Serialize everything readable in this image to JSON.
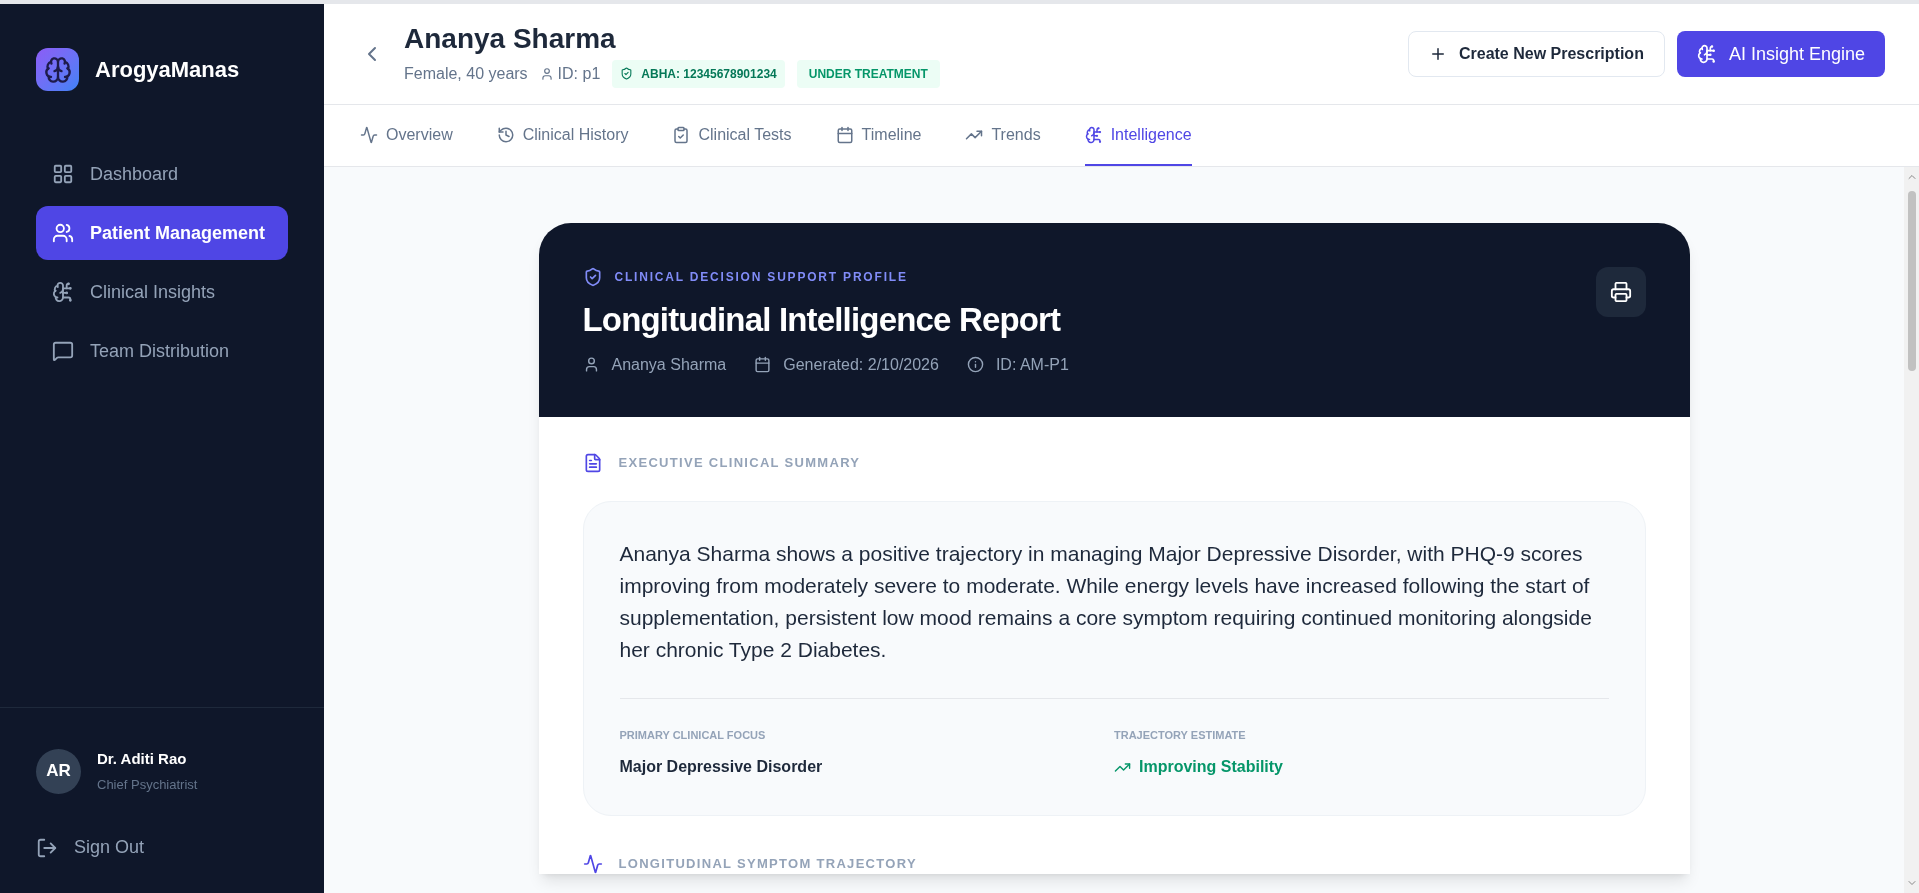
{
  "app": {
    "name": "ArogyaManas"
  },
  "sidebar": {
    "nav": [
      {
        "label": "Dashboard",
        "selected": false
      },
      {
        "label": "Patient Management",
        "selected": true
      },
      {
        "label": "Clinical Insights",
        "selected": false
      },
      {
        "label": "Team Distribution",
        "selected": false
      }
    ],
    "user": {
      "initials": "AR",
      "name": "Dr. Aditi Rao",
      "role": "Chief Psychiatrist"
    },
    "sign_out": "Sign Out"
  },
  "patient": {
    "name": "Ananya Sharma",
    "details": "Female, 40 years",
    "id": "ID: p1",
    "abha": "ABHA: 12345678901234",
    "status": "UNDER TREATMENT"
  },
  "header_buttons": [
    {
      "label": "Create New Prescription",
      "kind": "secondary"
    },
    {
      "label": "AI Insight Engine",
      "kind": "primary"
    }
  ],
  "tabs": [
    {
      "label": "Overview",
      "selected": false
    },
    {
      "label": "Clinical History",
      "selected": false
    },
    {
      "label": "Clinical Tests",
      "selected": false
    },
    {
      "label": "Timeline",
      "selected": false
    },
    {
      "label": "Trends",
      "selected": false
    },
    {
      "label": "Intelligence",
      "selected": true
    }
  ],
  "report": {
    "eyebrow": "CLINICAL DECISION SUPPORT PROFILE",
    "title": "Longitudinal Intelligence Report",
    "meta": [
      {
        "kind": "person",
        "text": "Ananya Sharma"
      },
      {
        "kind": "calendar",
        "text": "Generated: 2/10/2026"
      },
      {
        "kind": "info",
        "text": "ID: AM-P1"
      }
    ],
    "summary": {
      "heading": "EXECUTIVE CLINICAL SUMMARY",
      "text": "Ananya Sharma shows a positive trajectory in managing Major Depressive Disorder, with PHQ-9 scores improving from moderately severe to moderate. While energy levels have increased following the start of supplementation, persistent low mood remains a core symptom requiring continued monitoring alongside her chronic Type 2 Diabetes.",
      "fields": [
        {
          "label": "PRIMARY CLINICAL FOCUS",
          "value": "Major Depressive Disorder",
          "kind": "plain"
        },
        {
          "label": "TRAJECTORY ESTIMATE",
          "value": "Improving Stability",
          "kind": "trend"
        }
      ]
    },
    "next_section": "LONGITUDINAL SYMPTOM TRAJECTORY"
  }
}
